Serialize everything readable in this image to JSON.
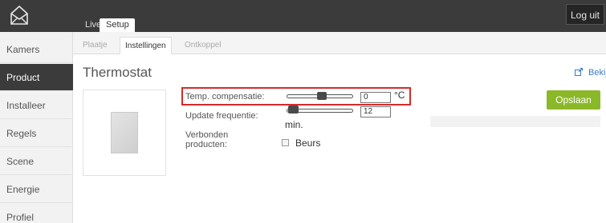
{
  "header": {
    "tabs": [
      {
        "label": "Live"
      },
      {
        "label": "Setup"
      }
    ],
    "logout_label": "Log uit",
    "logo_icon": "home-envelope-icon"
  },
  "sidebar": {
    "items": [
      {
        "label": "Kamers"
      },
      {
        "label": "Product",
        "active": true
      },
      {
        "label": "Installeer"
      },
      {
        "label": "Regels"
      },
      {
        "label": "Scene"
      },
      {
        "label": "Energie"
      },
      {
        "label": "Profiel"
      }
    ]
  },
  "subtabs": [
    {
      "label": "Plaatje"
    },
    {
      "label": "Instellingen",
      "active": true
    },
    {
      "label": "Ontkoppel"
    }
  ],
  "content": {
    "title": "Thermostat",
    "bekijk_label": "Bekijk",
    "save_label": "Opslaan",
    "temp": {
      "label": "Temp. compensatie:",
      "value": "0",
      "unit": "°C"
    },
    "update": {
      "label": "Update frequentie:",
      "value": "12",
      "unit": "min."
    },
    "verbonden": {
      "label": "Verbonden producten:",
      "options": [
        {
          "label": "Beurs",
          "checked": false
        }
      ]
    }
  },
  "colors": {
    "accent_green": "#8bb828",
    "topbar": "#3b3b3b",
    "highlight": "#d62a2a",
    "link": "#3a7abf"
  }
}
